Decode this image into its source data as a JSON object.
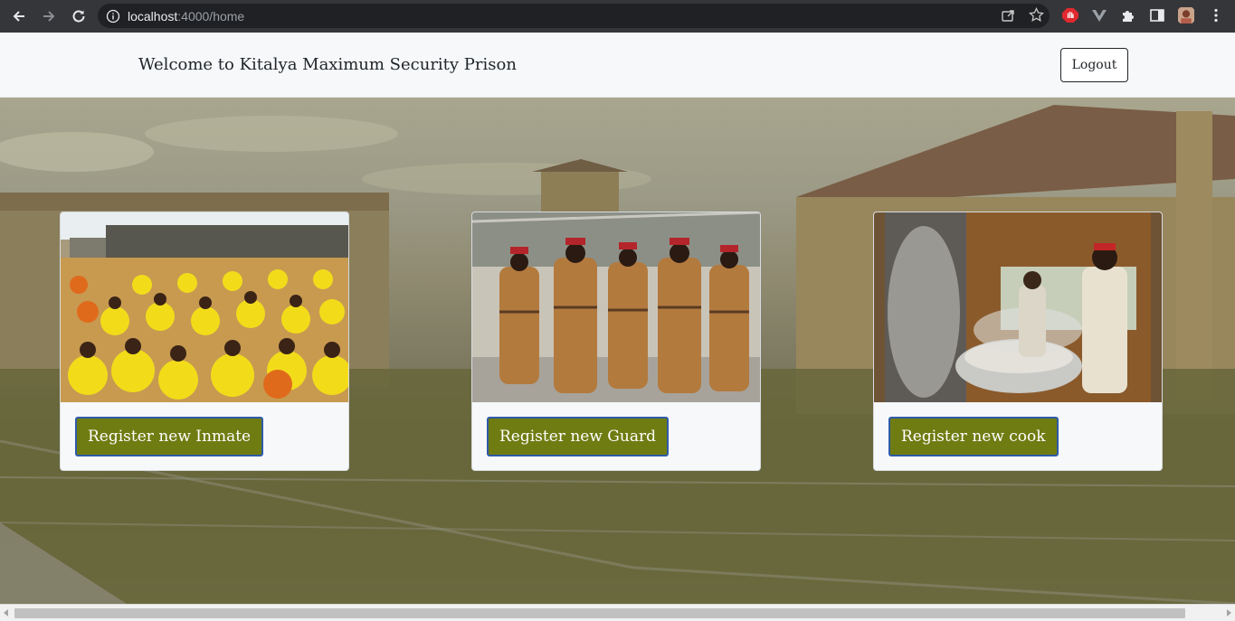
{
  "browser": {
    "url_host": "localhost",
    "url_rest": ":4000/home"
  },
  "navbar": {
    "brand": "Welcome to Kitalya Maximum Security Prison",
    "logout_label": "Logout"
  },
  "cards": [
    {
      "button_label": "Register new Inmate",
      "image": "inmates-photo"
    },
    {
      "button_label": "Register new Guard",
      "image": "guards-photo"
    },
    {
      "button_label": "Register new cook",
      "image": "kitchen-photo"
    }
  ],
  "colors": {
    "accent_button": "#6f7c12",
    "button_border": "#2f5aa8",
    "navbar_bg": "#f6f8fa"
  }
}
